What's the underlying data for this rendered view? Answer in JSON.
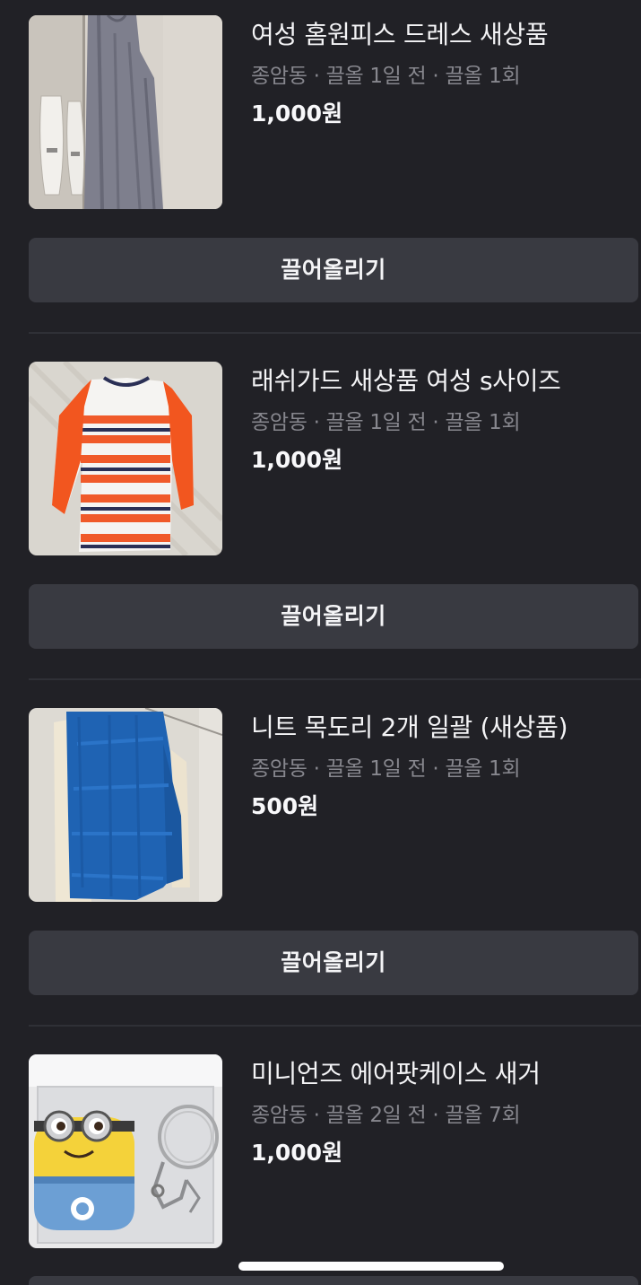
{
  "listings": [
    {
      "title": "여성 홈원피스 드레스 새상품",
      "meta": "종암동 · 끌올 1일 전 · 끌올 1회",
      "price": "1,000원",
      "bump_label": "끌어올리기",
      "photo": "grey-dress-photo"
    },
    {
      "title": "래쉬가드 새상품 여성 s사이즈",
      "meta": "종암동 · 끌올 1일 전 · 끌올 1회",
      "price": "1,000원",
      "bump_label": "끌어올리기",
      "photo": "striped-rashguard-photo"
    },
    {
      "title": "니트 목도리 2개 일괄 (새상품)",
      "meta": "종암동 · 끌올 1일 전 · 끌올 1회",
      "price": "500원",
      "bump_label": "끌어올리기",
      "photo": "blue-knit-scarf-photo"
    },
    {
      "title": "미니언즈 에어팟케이스 새거",
      "meta": "종암동 · 끌올 2일 전 · 끌올 7회",
      "price": "1,000원",
      "photo": "minion-airpods-case-photo"
    }
  ],
  "colors": {
    "background": "#212126",
    "button": "#393a41",
    "meta_text": "#87878e",
    "divider": "#2f3036"
  }
}
